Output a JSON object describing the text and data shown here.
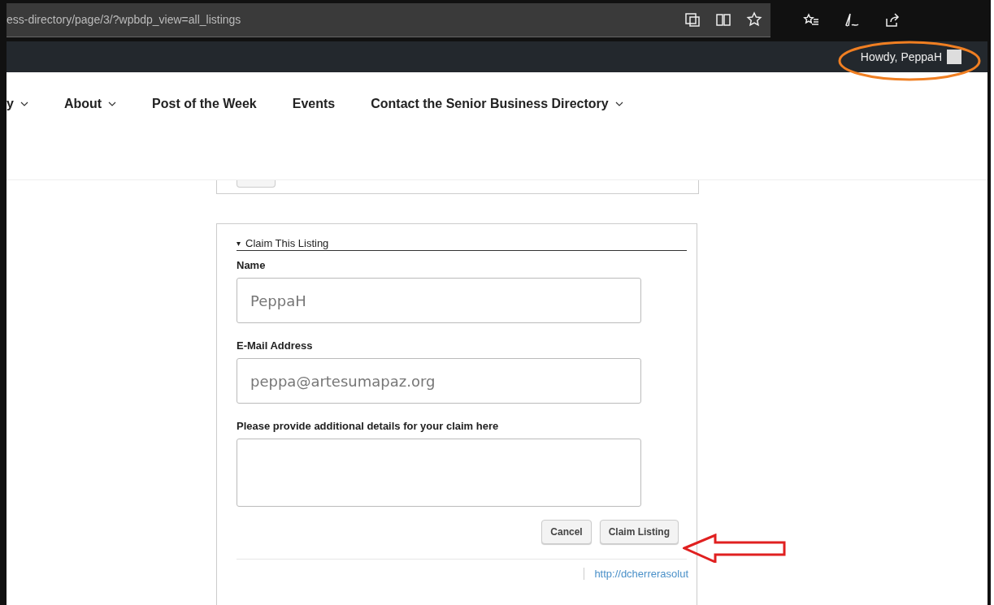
{
  "address_bar": {
    "url": "ess-directory/page/3/?wpbdp_view=all_listings"
  },
  "admin_bar": {
    "greeting": "Howdy, PeppaH"
  },
  "nav": [
    {
      "label": "y",
      "has_dropdown": true
    },
    {
      "label": "About",
      "has_dropdown": true
    },
    {
      "label": "Post of the Week",
      "has_dropdown": false
    },
    {
      "label": "Events",
      "has_dropdown": false
    },
    {
      "label": "Contact the Senior Business Directory",
      "has_dropdown": true
    }
  ],
  "claim_form": {
    "toggle": "▾",
    "title": "Claim This Listing",
    "expanded": true,
    "fields": [
      {
        "label": "Name",
        "kind": "input",
        "value": "PeppaH"
      },
      {
        "label": "E-Mail Address",
        "kind": "input",
        "value": "peppa@artesumapaz.org"
      },
      {
        "label": "Please provide additional details for your claim here",
        "kind": "textarea"
      }
    ],
    "buttons": [
      "Cancel",
      "Claim Listing"
    ]
  },
  "next_listing": {
    "link": "http://dcherrerasolut"
  }
}
